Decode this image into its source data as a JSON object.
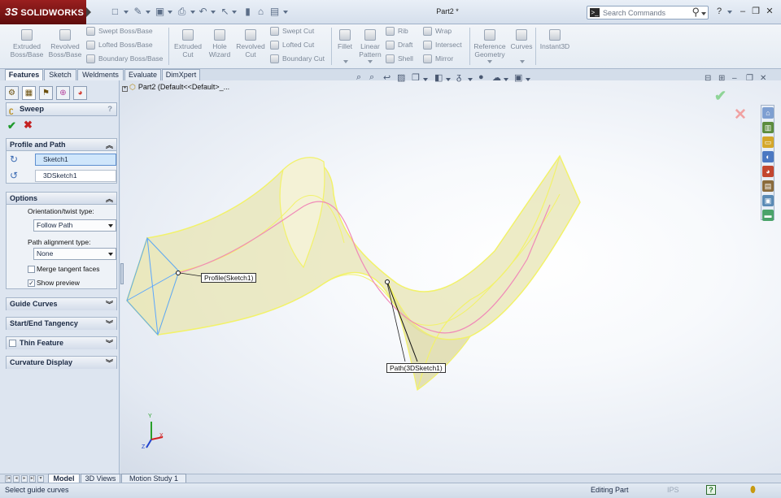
{
  "app": {
    "brand": "SOLIDWORKS",
    "brand_prefix": "3S",
    "document_title": "Part2 *"
  },
  "search": {
    "placeholder": "Search Commands"
  },
  "window_controls": {
    "help": "?",
    "minimize": "–",
    "restore": "❐",
    "close": "✕"
  },
  "command_manager": {
    "large_buttons": [
      {
        "id": "extruded-boss",
        "line1": "Extruded",
        "line2": "Boss/Base"
      },
      {
        "id": "revolved-boss",
        "line1": "Revolved",
        "line2": "Boss/Base"
      },
      {
        "id": "extruded-cut",
        "line1": "Extruded",
        "line2": "Cut"
      },
      {
        "id": "hole-wizard",
        "line1": "Hole",
        "line2": "Wizard"
      },
      {
        "id": "revolved-cut",
        "line1": "Revolved",
        "line2": "Cut"
      },
      {
        "id": "fillet",
        "line1": "Fillet",
        "line2": ""
      },
      {
        "id": "linear-pattern",
        "line1": "Linear",
        "line2": "Pattern"
      },
      {
        "id": "reference-geometry",
        "line1": "Reference",
        "line2": "Geometry"
      },
      {
        "id": "curves",
        "line1": "Curves",
        "line2": ""
      },
      {
        "id": "instant3d",
        "line1": "Instant3D",
        "line2": ""
      }
    ],
    "small_buttons": {
      "swept_boss": "Swept Boss/Base",
      "lofted_boss": "Lofted Boss/Base",
      "boundary_boss": "Boundary Boss/Base",
      "swept_cut": "Swept Cut",
      "lofted_cut": "Lofted Cut",
      "boundary_cut": "Boundary Cut",
      "rib": "Rib",
      "draft": "Draft",
      "shell": "Shell",
      "wrap": "Wrap",
      "intersect": "Intersect",
      "mirror": "Mirror"
    },
    "tabs": [
      "Features",
      "Sketch",
      "Weldments",
      "Evaluate",
      "DimXpert"
    ]
  },
  "property_manager": {
    "title": "Sweep",
    "help": "?",
    "profile_and_path": {
      "header": "Profile and Path",
      "profile": "Sketch1",
      "path": "3DSketch1",
      "profile_color": "#4aa3ff",
      "path_color": "#f28ad0"
    },
    "options": {
      "header": "Options",
      "orientation_label": "Orientation/twist type:",
      "orientation_value": "Follow Path",
      "path_alignment_label": "Path alignment type:",
      "path_alignment_value": "None",
      "merge_tangent_faces": {
        "label": "Merge tangent faces",
        "checked": false
      },
      "show_preview": {
        "label": "Show preview",
        "checked": true
      }
    },
    "collapsed_groups": [
      "Guide Curves",
      "Start/End Tangency",
      "Thin Feature",
      "Curvature Display"
    ]
  },
  "graphics": {
    "tree_label": "Part2  (Default<<Default>_...",
    "callouts": {
      "profile": "Profile(Sketch1)",
      "path": "Path(3DSketch1)"
    },
    "triad": {
      "x": "X",
      "y": "Y",
      "z": "Z"
    }
  },
  "bottom_tabs": [
    "Model",
    "3D Views",
    "Motion Study 1"
  ],
  "status": {
    "message": "Select guide curves",
    "mode": "Editing Part",
    "units": "IPS",
    "help": "?"
  },
  "colors": {
    "brand_red": "#8e1a1a",
    "preview_yellow": "#f2f26a",
    "ok_green": "#1f9a2c",
    "cancel_red": "#c42222"
  }
}
